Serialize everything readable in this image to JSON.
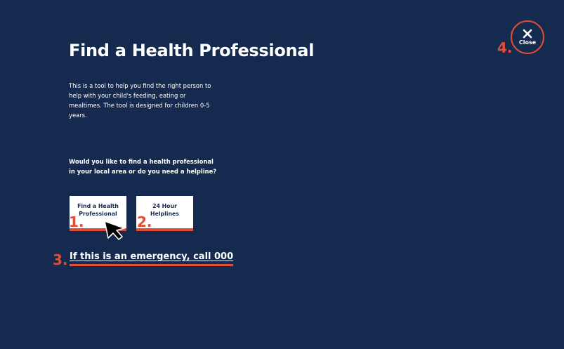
{
  "page": {
    "title": "Find a Health Professional",
    "intro": "This is a tool to help you find the right person to help with your child's feeding, eating or mealtimes. The tool is designed for children 0-5 years.",
    "question": "Would you like to find a health professional in your local area or do you need a helpline?"
  },
  "choices": [
    {
      "label": "Find a Health Professional",
      "number": "1."
    },
    {
      "label": "24 Hour Helplines",
      "number": "2."
    }
  ],
  "emergency": {
    "label": "If this is an emergency, call 000",
    "number": "3."
  },
  "close": {
    "label": "Close",
    "number": "4.",
    "icon": "close-icon"
  },
  "colors": {
    "background": "#142a4e",
    "accent": "#e04e37",
    "text": "#ffffff"
  }
}
